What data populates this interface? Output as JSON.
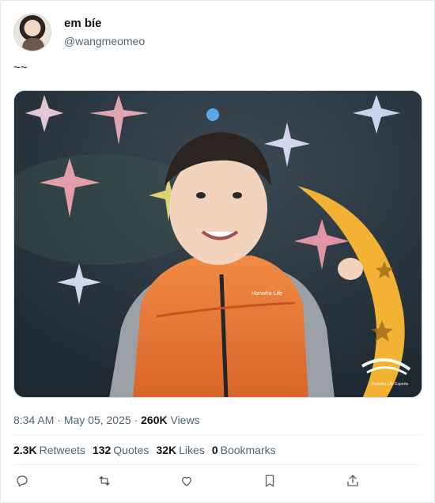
{
  "user": {
    "display_name": "em bíe",
    "handle": "@wangmeomeo"
  },
  "tweet": {
    "text": "~~",
    "time": "8:34 AM",
    "date": "May 05, 2025",
    "views_count": "260K",
    "views_label": "Views"
  },
  "stats": [
    {
      "count": "2.3K",
      "label": "Retweets"
    },
    {
      "count": "132",
      "label": "Quotes"
    },
    {
      "count": "32K",
      "label": "Likes"
    },
    {
      "count": "0",
      "label": "Bookmarks"
    }
  ],
  "media": {
    "jacket_text": "Hanwha Life",
    "logo_text": "Hanwha Life Esports"
  },
  "actions": [
    "reply-icon",
    "retweet-icon",
    "like-icon",
    "bookmark-icon",
    "share-icon"
  ],
  "colors": {
    "text_primary": "#0f1419",
    "text_secondary": "#536471",
    "border": "#e1e8ed",
    "jacket_orange": "#e8742f",
    "moon_yellow": "#f2b233"
  }
}
